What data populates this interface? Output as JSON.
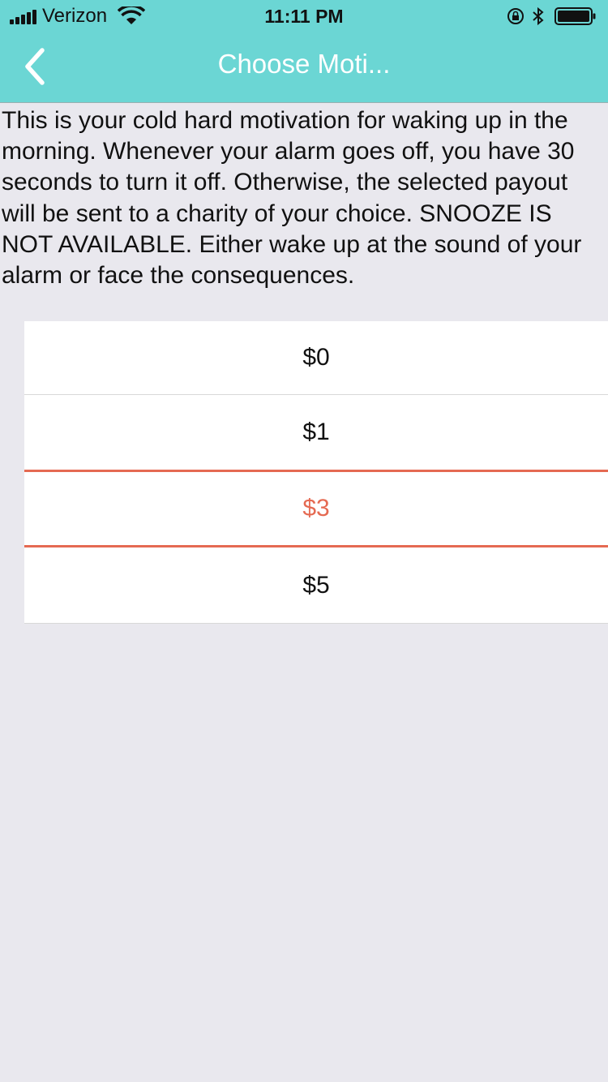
{
  "status_bar": {
    "carrier": "Verizon",
    "time": "11:11 PM",
    "icons": [
      "signal-icon",
      "wifi-icon",
      "rotation-lock-icon",
      "bluetooth-icon",
      "battery-icon"
    ]
  },
  "nav": {
    "title": "Choose Moti...",
    "back_icon": "chevron-left-icon",
    "bar_color": "#6bd6d4"
  },
  "description": "This is your cold hard motivation for waking up in the morning. Whenever your alarm goes off, you have 30 seconds to turn it off. Otherwise, the selected payout will be sent to a charity of your choice. SNOOZE IS NOT AVAILABLE. Either wake up at the sound of your alarm or face the consequences.",
  "options": [
    {
      "label": "$0",
      "selected": false
    },
    {
      "label": "$1",
      "selected": false
    },
    {
      "label": "$3",
      "selected": true
    },
    {
      "label": "$5",
      "selected": false
    }
  ],
  "colors": {
    "accent": "#e56a52",
    "background": "#e9e8ee"
  }
}
